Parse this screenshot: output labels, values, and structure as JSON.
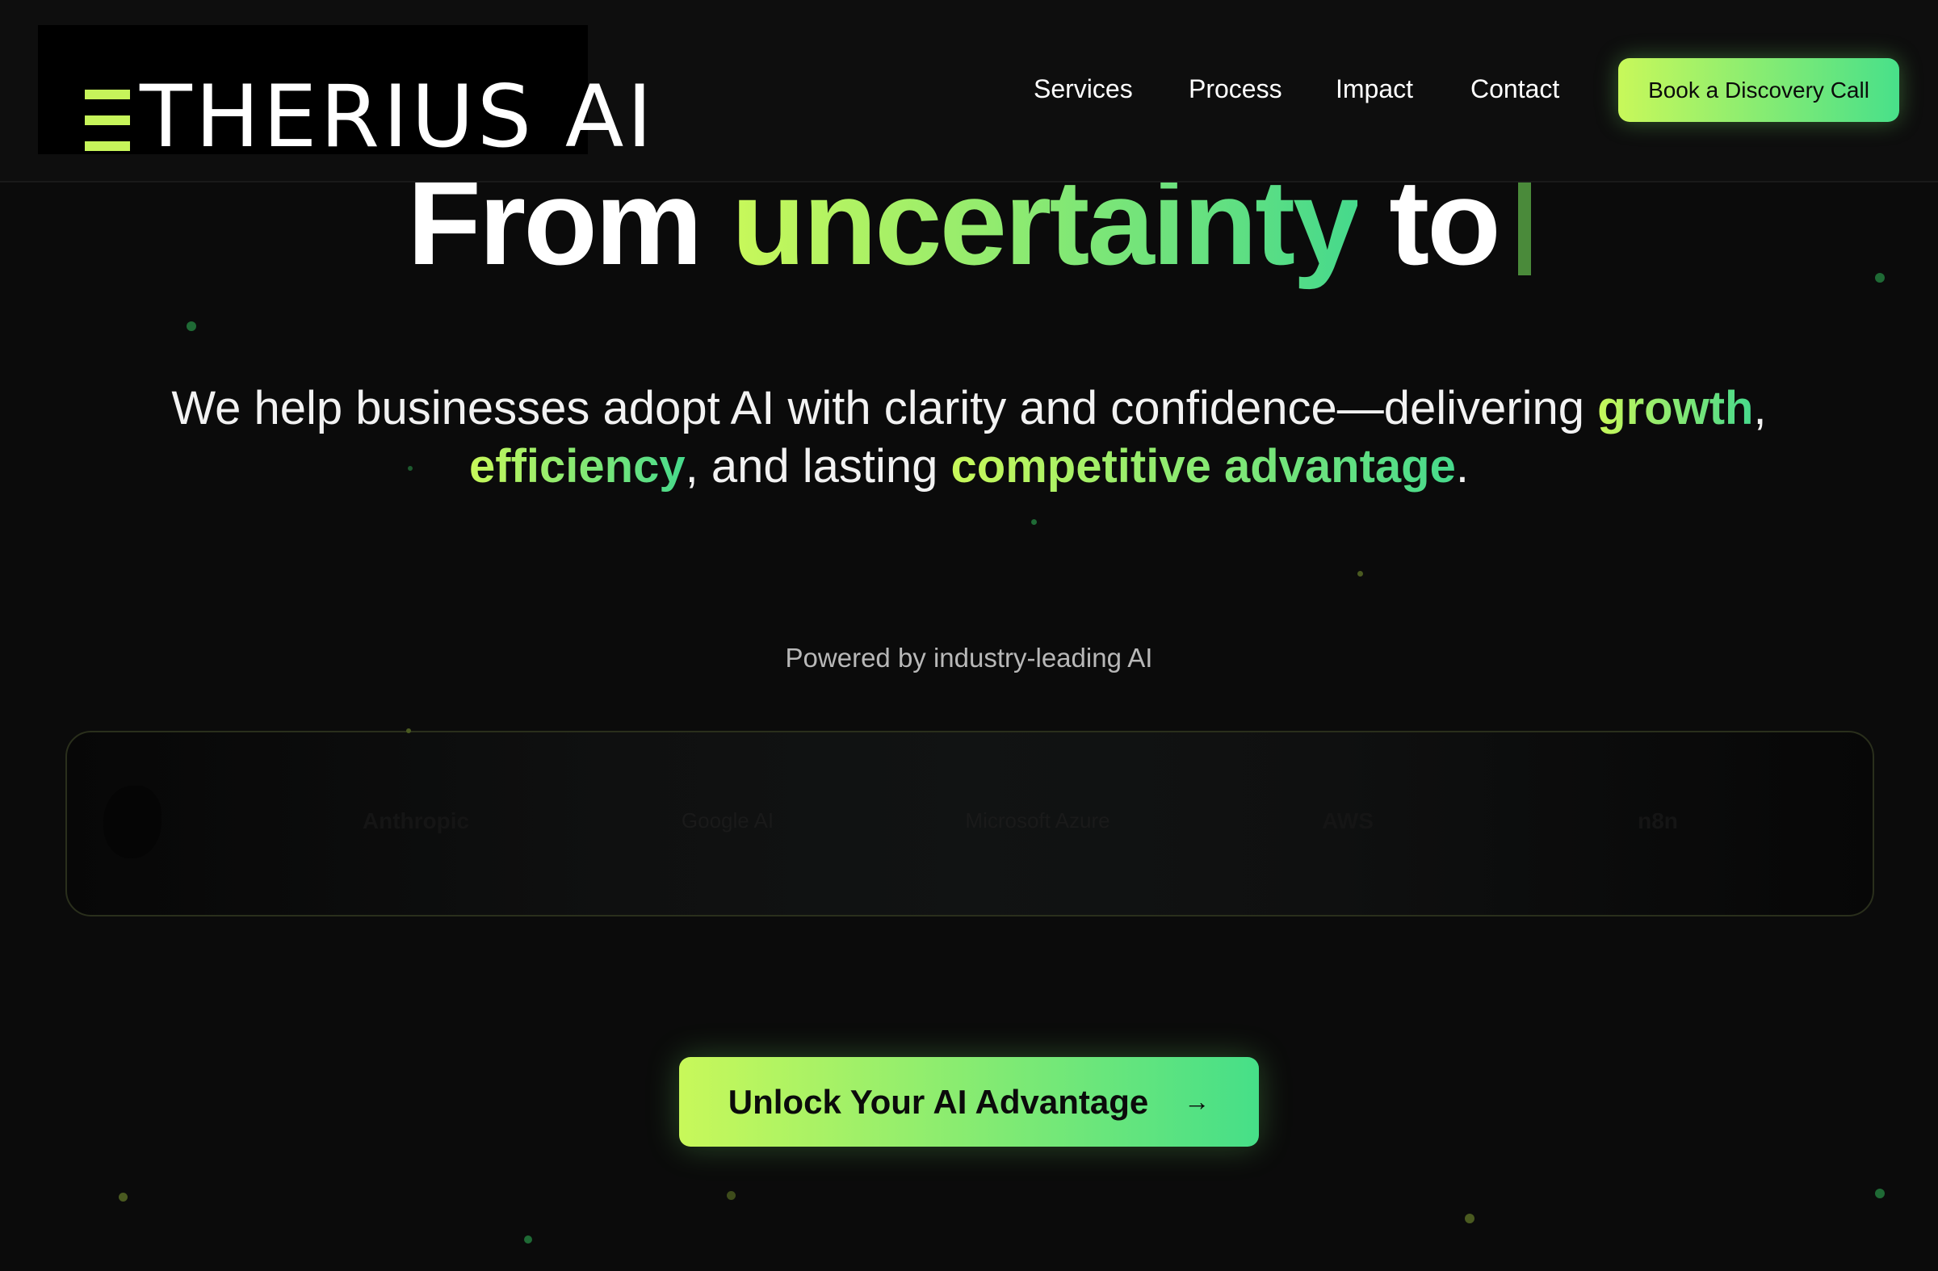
{
  "brand": {
    "logo_text": "ETHERIUS AI",
    "accent_color": "#c6f45a",
    "gradient_start": "#c8f85a",
    "gradient_end": "#46d98c",
    "background": "#0b0b0b"
  },
  "nav": {
    "links": [
      "Services",
      "Process",
      "Impact",
      "Contact"
    ],
    "cta_label": "Book a Discovery Call"
  },
  "hero": {
    "headline_prefix": "From",
    "headline_highlight": "uncertainty",
    "headline_suffix": "to",
    "sub_part1": "We help businesses adopt AI with clarity and confidence—delivering",
    "sub_hl1": "growth",
    "sub_part2": ",",
    "sub_hl2": "efficiency",
    "sub_part3": ", and lasting",
    "sub_hl3": "competitive advantage",
    "sub_part4": "."
  },
  "partners": {
    "title": "Powered by industry-leading AI",
    "items": [
      "Anthropic",
      "Google AI",
      "Microsoft Azure",
      "AWS",
      "n8n"
    ]
  },
  "cta": {
    "label": "Unlock Your AI Advantage",
    "icon": "arrow-right-icon",
    "arrow_glyph": "→"
  }
}
